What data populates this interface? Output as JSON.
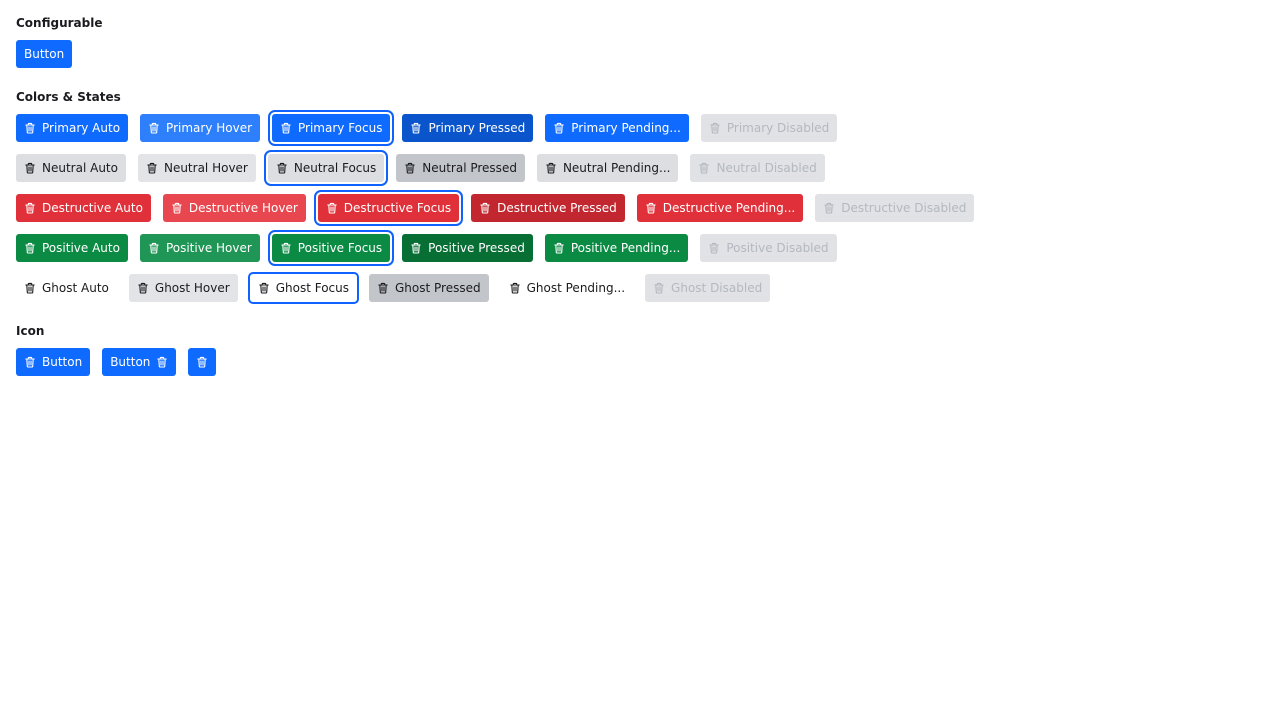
{
  "sections": {
    "configurable": {
      "title": "Configurable",
      "button_label": "Button"
    },
    "colors_states": {
      "title": "Colors & States",
      "primary": [
        "Primary Auto",
        "Primary Hover",
        "Primary Focus",
        "Primary Pressed",
        "Primary Pending...",
        "Primary Disabled"
      ],
      "neutral": [
        "Neutral Auto",
        "Neutral Hover",
        "Neutral Focus",
        "Neutral Pressed",
        "Neutral Pending...",
        "Neutral Disabled"
      ],
      "destructive": [
        "Destructive Auto",
        "Destructive Hover",
        "Destructive Focus",
        "Destructive Pressed",
        "Destructive Pending...",
        "Destructive Disabled"
      ],
      "positive": [
        "Positive Auto",
        "Positive Hover",
        "Positive Focus",
        "Positive Pressed",
        "Positive Pending...",
        "Positive Disabled"
      ],
      "ghost": [
        "Ghost Auto",
        "Ghost Hover",
        "Ghost Focus",
        "Ghost Pressed",
        "Ghost Pending...",
        "Ghost Disabled"
      ]
    },
    "icon": {
      "title": "Icon",
      "icon_start_label": "Button",
      "icon_end_label": "Button"
    }
  },
  "icons": {
    "trash": "trash-icon"
  },
  "colors": {
    "primary": "#0f6bff",
    "neutral": "#dcdee2",
    "destructive": "#e0313a",
    "positive": "#0b8a43",
    "ghost": "#ffffff",
    "disabled_bg": "#e0e2e6",
    "disabled_text": "#b4b8bf",
    "focus_ring": "#0f62fe"
  }
}
